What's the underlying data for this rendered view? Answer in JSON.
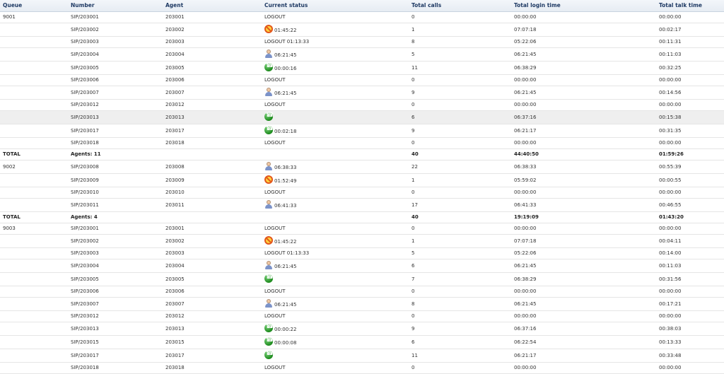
{
  "headers": {
    "queue": "Queue",
    "number": "Number",
    "agent": "Agent",
    "status": "Current status",
    "calls": "Total calls",
    "login": "Total login time",
    "talk": "Total talk time"
  },
  "rows": [
    {
      "queue": "9001",
      "number": "SIP/203001",
      "agent": "203001",
      "status": "LOGOUT",
      "icon": "",
      "calls": "0",
      "login": "00:00:00",
      "talk": "00:00:00"
    },
    {
      "queue": "",
      "number": "SIP/203002",
      "agent": "203002",
      "status": "01:45:22",
      "icon": "busy",
      "calls": "1",
      "login": "07:07:18",
      "talk": "00:02:17"
    },
    {
      "queue": "",
      "number": "SIP/203003",
      "agent": "203003",
      "status": "LOGOUT 01:13:33",
      "icon": "",
      "calls": "8",
      "login": "05:22:06",
      "talk": "00:11:31"
    },
    {
      "queue": "",
      "number": "SIP/203004",
      "agent": "203004",
      "status": "06:21:45",
      "icon": "user",
      "calls": "5",
      "login": "06:21:45",
      "talk": "00:11:03"
    },
    {
      "queue": "",
      "number": "SIP/203005",
      "agent": "203005",
      "status": "00:00:16",
      "icon": "phone",
      "calls": "11",
      "login": "06:38:29",
      "talk": "00:32:25"
    },
    {
      "queue": "",
      "number": "SIP/203006",
      "agent": "203006",
      "status": "LOGOUT",
      "icon": "",
      "calls": "0",
      "login": "00:00:00",
      "talk": "00:00:00"
    },
    {
      "queue": "",
      "number": "SIP/203007",
      "agent": "203007",
      "status": "06:21:45",
      "icon": "user",
      "calls": "9",
      "login": "06:21:45",
      "talk": "00:14:56"
    },
    {
      "queue": "",
      "number": "SIP/203012",
      "agent": "203012",
      "status": "LOGOUT",
      "icon": "",
      "calls": "0",
      "login": "00:00:00",
      "talk": "00:00:00"
    },
    {
      "queue": "",
      "number": "SIP/203013",
      "agent": "203013",
      "status": "",
      "icon": "phone",
      "calls": "6",
      "login": "06:37:16",
      "talk": "00:15:38",
      "highlight": true
    },
    {
      "queue": "",
      "number": "SIP/203017",
      "agent": "203017",
      "status": "00:02:18",
      "icon": "phone",
      "calls": "9",
      "login": "06:21:17",
      "talk": "00:31:35"
    },
    {
      "queue": "",
      "number": "SIP/203018",
      "agent": "203018",
      "status": "LOGOUT",
      "icon": "",
      "calls": "0",
      "login": "00:00:00",
      "talk": "00:00:00"
    },
    {
      "total": true,
      "queue": "TOTAL",
      "number": "Agents: 11",
      "agent": "",
      "status": "",
      "icon": "",
      "calls": "40",
      "login": "44:40:50",
      "talk": "01:59:26"
    },
    {
      "queue": "9002",
      "number": "SIP/203008",
      "agent": "203008",
      "status": "06:38:33",
      "icon": "user",
      "calls": "22",
      "login": "06:38:33",
      "talk": "00:55:39"
    },
    {
      "queue": "",
      "number": "SIP/203009",
      "agent": "203009",
      "status": "01:52:49",
      "icon": "busy",
      "calls": "1",
      "login": "05:59:02",
      "talk": "00:00:55"
    },
    {
      "queue": "",
      "number": "SIP/203010",
      "agent": "203010",
      "status": "LOGOUT",
      "icon": "",
      "calls": "0",
      "login": "00:00:00",
      "talk": "00:00:00"
    },
    {
      "queue": "",
      "number": "SIP/203011",
      "agent": "203011",
      "status": "06:41:33",
      "icon": "user",
      "calls": "17",
      "login": "06:41:33",
      "talk": "00:46:55"
    },
    {
      "total": true,
      "queue": "TOTAL",
      "number": "Agents: 4",
      "agent": "",
      "status": "",
      "icon": "",
      "calls": "40",
      "login": "19:19:09",
      "talk": "01:43:20"
    },
    {
      "queue": "9003",
      "number": "SIP/203001",
      "agent": "203001",
      "status": "LOGOUT",
      "icon": "",
      "calls": "0",
      "login": "00:00:00",
      "talk": "00:00:00"
    },
    {
      "queue": "",
      "number": "SIP/203002",
      "agent": "203002",
      "status": "01:45:22",
      "icon": "busy",
      "calls": "1",
      "login": "07:07:18",
      "talk": "00:04:11"
    },
    {
      "queue": "",
      "number": "SIP/203003",
      "agent": "203003",
      "status": "LOGOUT 01:13:33",
      "icon": "",
      "calls": "5",
      "login": "05:22:06",
      "talk": "00:14:00"
    },
    {
      "queue": "",
      "number": "SIP/203004",
      "agent": "203004",
      "status": "06:21:45",
      "icon": "user",
      "calls": "6",
      "login": "06:21:45",
      "talk": "00:11:03"
    },
    {
      "queue": "",
      "number": "SIP/203005",
      "agent": "203005",
      "status": "",
      "icon": "phone",
      "calls": "7",
      "login": "06:38:29",
      "talk": "00:31:56"
    },
    {
      "queue": "",
      "number": "SIP/203006",
      "agent": "203006",
      "status": "LOGOUT",
      "icon": "",
      "calls": "0",
      "login": "00:00:00",
      "talk": "00:00:00"
    },
    {
      "queue": "",
      "number": "SIP/203007",
      "agent": "203007",
      "status": "06:21:45",
      "icon": "user",
      "calls": "8",
      "login": "06:21:45",
      "talk": "00:17:21"
    },
    {
      "queue": "",
      "number": "SIP/203012",
      "agent": "203012",
      "status": "LOGOUT",
      "icon": "",
      "calls": "0",
      "login": "00:00:00",
      "talk": "00:00:00"
    },
    {
      "queue": "",
      "number": "SIP/203013",
      "agent": "203013",
      "status": "00:00:22",
      "icon": "phone",
      "calls": "9",
      "login": "06:37:16",
      "talk": "00:38:03"
    },
    {
      "queue": "",
      "number": "SIP/203015",
      "agent": "203015",
      "status": "00:00:08",
      "icon": "phone",
      "calls": "6",
      "login": "06:22:54",
      "talk": "00:13:33"
    },
    {
      "queue": "",
      "number": "SIP/203017",
      "agent": "203017",
      "status": "",
      "icon": "phone",
      "calls": "11",
      "login": "06:21:17",
      "talk": "00:33:48"
    },
    {
      "queue": "",
      "number": "SIP/203018",
      "agent": "203018",
      "status": "LOGOUT",
      "icon": "",
      "calls": "0",
      "login": "00:00:00",
      "talk": "00:00:00"
    }
  ],
  "icons": {
    "busy": "busy-icon",
    "user": "user-icon",
    "phone": "phone-icon"
  },
  "colors": {
    "header_text": "#1f3a64",
    "header_bg": "#e9eef4",
    "highlight_row": "#efefef",
    "phone_green": "#1c8a1c",
    "busy_orange": "#e2561b"
  }
}
